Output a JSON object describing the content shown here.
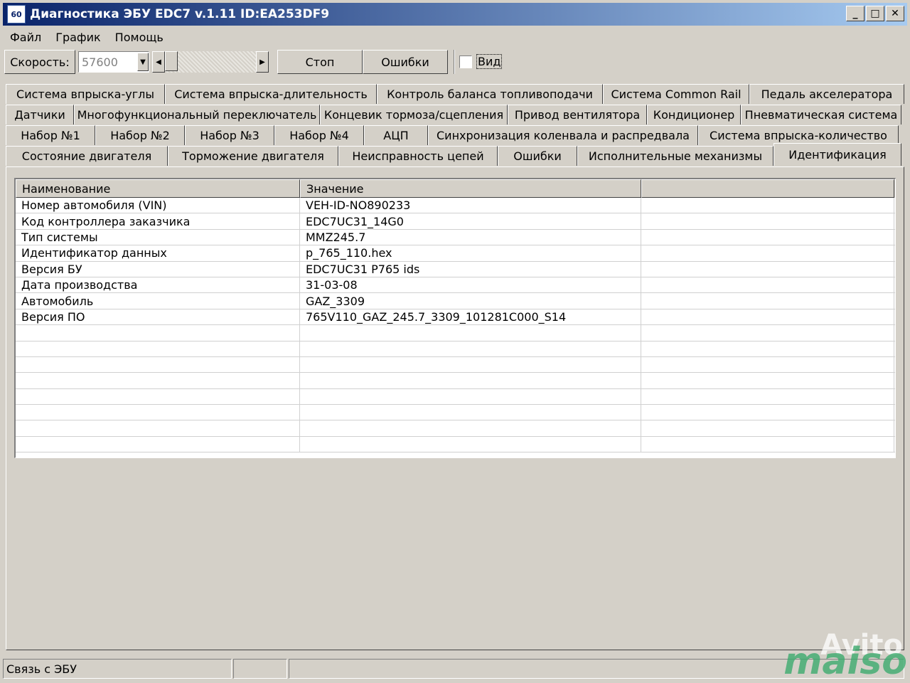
{
  "window": {
    "title": "Диагностика ЭБУ EDC7 v.1.11 ID:EA253DF9",
    "app_icon": "60"
  },
  "menu": [
    "Файл",
    "График",
    "Помощь"
  ],
  "toolbar": {
    "speed_label": "Скорость:",
    "speed_value": "57600",
    "stop_label": "Стоп",
    "errors_label": "Ошибки",
    "view_label": "Вид"
  },
  "tabs": {
    "row1": [
      "Система впрыска-углы",
      "Система впрыска-длительность",
      "Контроль баланса топливоподачи",
      "Система Common Rail",
      "Педаль акселератора"
    ],
    "row2": [
      "Датчики",
      "Многофункциональный переключатель",
      "Концевик тормоза/сцепления",
      "Привод вентилятора",
      "Кондиционер",
      "Пневматическая система"
    ],
    "row3": [
      "Набор №1",
      "Набор №2",
      "Набор №3",
      "Набор №4",
      "АЦП",
      "Синхронизация коленвала и распредвала",
      "Система впрыска-количество"
    ],
    "row4": [
      "Состояние двигателя",
      "Торможение двигателя",
      "Неисправность цепей",
      "Ошибки",
      "Исполнительные механизмы",
      "Идентификация"
    ],
    "active": "Идентификация"
  },
  "grid": {
    "columns": [
      "Наименование",
      "Значение",
      ""
    ],
    "rows": [
      [
        "Номер автомобиля (VIN)",
        "VEH-ID-NO890233",
        ""
      ],
      [
        "Код контроллера заказчика",
        "EDC7UC31_14G0",
        ""
      ],
      [
        "Тип системы",
        "MMZ245.7",
        ""
      ],
      [
        "Идентификатор данных",
        "p_765_110.hex",
        ""
      ],
      [
        "Версия БУ",
        "EDC7UC31 P765 ids",
        ""
      ],
      [
        "Дата производства",
        "31-03-08",
        ""
      ],
      [
        "Автомобиль",
        "GAZ_3309",
        ""
      ],
      [
        "Версия ПО",
        "765V110_GAZ_245.7_3309_101281C000_S14",
        ""
      ]
    ],
    "empty_rows": 8
  },
  "status": {
    "connection": "Связь с ЭБУ"
  },
  "watermark": {
    "avito": "Avito",
    "maiso": "maiso"
  }
}
